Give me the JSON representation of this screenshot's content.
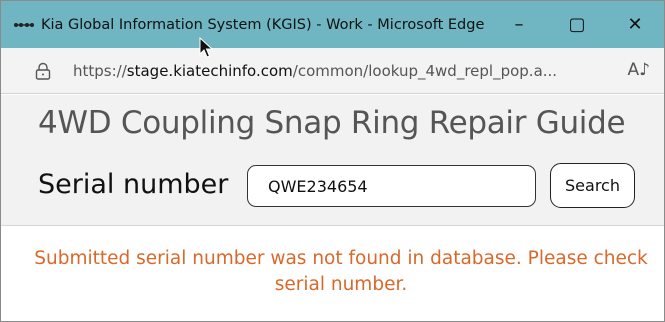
{
  "window": {
    "title": "Kia Global Information System (KGIS) - Work - Microsoft Edge",
    "controls": {
      "minimize": "–",
      "maximize": "▢",
      "close": "✕"
    }
  },
  "address_bar": {
    "scheme": "https://",
    "host": "stage.kiatechinfo.com",
    "path": "/common/lookup_4wd_repl_pop.a...",
    "read_aloud_icon": "A♪"
  },
  "page": {
    "title": "4WD Coupling Snap Ring Repair Guide",
    "serial_label": "Serial number",
    "serial_value": "QWE234654",
    "search_label": "Search",
    "error_message": "Submitted serial number was not found in database. Please check serial number.",
    "error_color": "#d9682a"
  },
  "colors": {
    "titlebar": "#6fb6c2",
    "addressbar": "#f3f3f3",
    "header_bg": "#f2f2f2"
  }
}
